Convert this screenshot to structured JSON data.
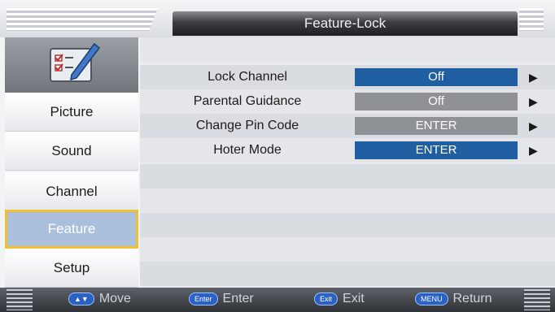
{
  "header": {
    "title": "Feature-Lock"
  },
  "sidebar": {
    "items": [
      {
        "label": "Picture"
      },
      {
        "label": "Sound"
      },
      {
        "label": "Channel"
      },
      {
        "label": "Feature"
      },
      {
        "label": "Setup"
      }
    ],
    "active": "Feature"
  },
  "settings": [
    {
      "label": "Lock Channel",
      "value": "Off",
      "style": "blue"
    },
    {
      "label": "Parental Guidance",
      "value": "Off",
      "style": "gray"
    },
    {
      "label": "Change Pin Code",
      "value": "ENTER",
      "style": "gray"
    },
    {
      "label": "Hoter Mode",
      "value": "ENTER",
      "style": "blue"
    }
  ],
  "footer": {
    "move": {
      "key": "▲▼",
      "label": "Move"
    },
    "enter": {
      "key": "Enter",
      "label": "Enter"
    },
    "exit": {
      "key": "Exit",
      "label": "Exit"
    },
    "return": {
      "key": "MENU",
      "label": "Return"
    }
  },
  "colors": {
    "accent_blue": "#1f5ea1",
    "active_menu": "#a9bfdc",
    "focus_border": "#f0c230"
  }
}
